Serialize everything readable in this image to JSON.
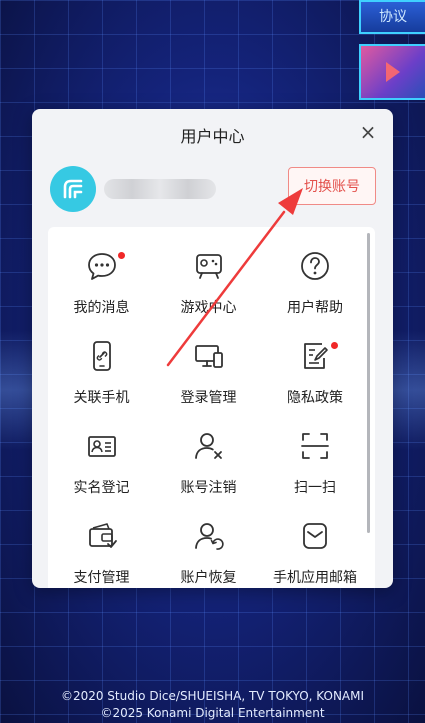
{
  "top_buttons": {
    "protocol": "协议"
  },
  "modal": {
    "title": "用户中心",
    "close": "×",
    "switch_account": "切换账号"
  },
  "menu": [
    {
      "label": "我的消息",
      "icon": "message-icon",
      "badge": true
    },
    {
      "label": "游戏中心",
      "icon": "gamepad-icon",
      "badge": false
    },
    {
      "label": "用户帮助",
      "icon": "help-icon",
      "badge": false
    },
    {
      "label": "关联手机",
      "icon": "phone-link-icon",
      "badge": false
    },
    {
      "label": "登录管理",
      "icon": "devices-icon",
      "badge": false
    },
    {
      "label": "隐私政策",
      "icon": "policy-icon",
      "badge": true
    },
    {
      "label": "实名登记",
      "icon": "id-card-icon",
      "badge": false
    },
    {
      "label": "账号注销",
      "icon": "user-remove-icon",
      "badge": false
    },
    {
      "label": "扫一扫",
      "icon": "scan-icon",
      "badge": false
    },
    {
      "label": "支付管理",
      "icon": "wallet-icon",
      "badge": false
    },
    {
      "label": "账户恢复",
      "icon": "user-restore-icon",
      "badge": false
    },
    {
      "label": "手机应用邮箱",
      "icon": "mail-icon",
      "badge": false
    }
  ],
  "footer": {
    "line1": "©2020 Studio Dice/SHUEISHA, TV TOKYO, KONAMI",
    "line2": "©2025 Konami Digital Entertainment"
  },
  "colors": {
    "accent_red": "#e3524d",
    "avatar": "#36c9e3",
    "badge": "#f02828"
  }
}
